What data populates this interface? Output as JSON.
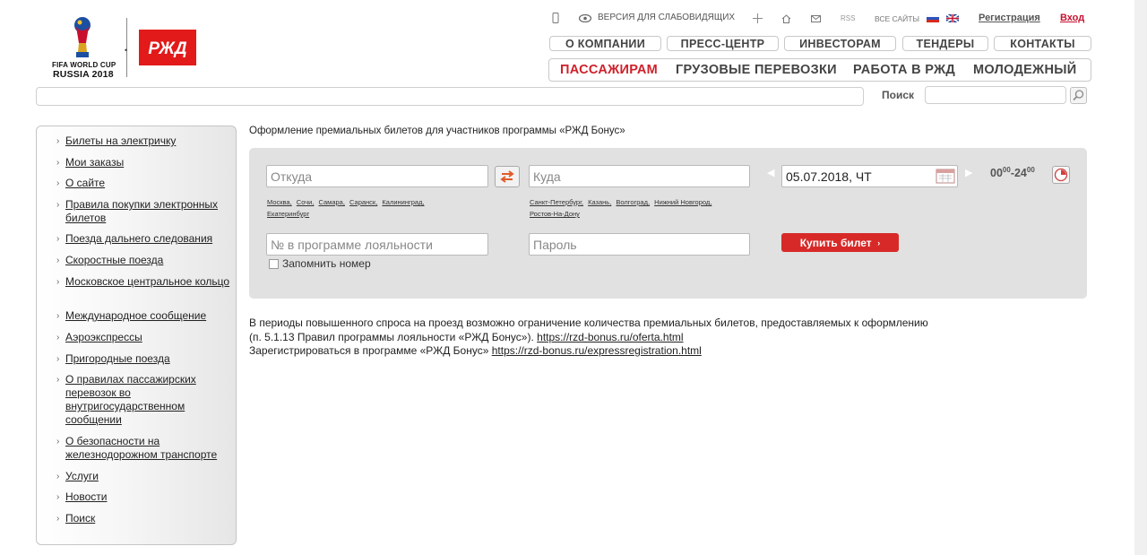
{
  "header": {
    "fifa_line1": "FIFA WORLD CUP",
    "fifa_line2": "RUSSIA 2018",
    "logo_text": "РЖД",
    "util": {
      "accessible_version": "ВЕРСИЯ ДЛЯ СЛАБОВИДЯЩИХ",
      "rss": "RSS",
      "all_sites": "ВСЕ САЙТЫ",
      "register": "Регистрация",
      "login": "Вход"
    },
    "nav_top": [
      "О КОМПАНИИ",
      "ПРЕСС-ЦЕНТР",
      "ИНВЕСТОРАМ",
      "ТЕНДЕРЫ",
      "КОНТАКТЫ"
    ],
    "nav_main": [
      "ПАССАЖИРАМ",
      "ГРУЗОВЫЕ ПЕРЕВОЗКИ",
      "РАБОТА В РЖД",
      "МОЛОДЕЖНЫЙ"
    ],
    "search_label": "Поиск",
    "accent_color": "#e21a1a"
  },
  "sidebar": {
    "items": [
      "Билеты на электричку",
      "Мои заказы",
      "О сайте",
      "Правила покупки электронных билетов",
      "Поезда дальнего следования",
      "Скоростные поезда",
      "Московское центральное кольцо",
      "Международное сообщение",
      "Аэроэкспрессы",
      "Пригородные поезда",
      "О правилах пассажирских перевозок во внутригосударственном сообщении",
      "О безопасности на железнодорожном транспорте",
      "Услуги",
      "Новости",
      "Поиск"
    ]
  },
  "main": {
    "title": "Оформление премиальных билетов для участников программы «РЖД Бонус»",
    "from_placeholder": "Откуда",
    "to_placeholder": "Куда",
    "from_cities": [
      "Москва,",
      "Сочи,",
      "Самара,",
      "Саранск,",
      "Калининград,",
      "Екатеринбург"
    ],
    "to_cities": [
      "Санкт-Петербург,",
      "Казань,",
      "Волгоград,",
      "Нижний Новгород,",
      "Ростов-На-Дону"
    ],
    "date_value": "05.07.2018, ЧТ",
    "time_from": "00",
    "time_from_sup": "00",
    "time_sep": "-",
    "time_to": "24",
    "time_to_sup": "00",
    "loyalty_placeholder": "№ в программе лояльности",
    "password_placeholder": "Пароль",
    "buy_label": "Купить билет",
    "remember_label": "Запомнить номер",
    "note_line1": "В периоды повышенного спроса на проезд возможно ограничение количества премиальных билетов, предоставляемых к оформлению",
    "note_line2_text": "(п. 5.1.13 Правил программы лояльности «РЖД Бонус»).",
    "note_line2_link": "https://rzd-bonus.ru/oferta.html",
    "note_line3_text": "Зарегистрироваться в программе «РЖД Бонус»",
    "note_line3_link": "https://rzd-bonus.ru/expressregistration.html",
    "buy_color": "#d72a28"
  }
}
